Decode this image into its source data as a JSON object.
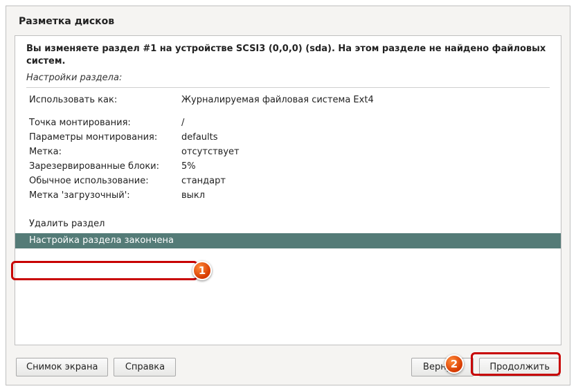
{
  "title": "Разметка дисков",
  "info": "Вы изменяете раздел #1 на устройстве SCSI3 (0,0,0) (sda). На этом разделе не найдено файловых систем.",
  "subtitle": "Настройки раздела:",
  "settings": [
    {
      "label": "Использовать как:",
      "value": "Журналируемая файловая система Ext4"
    },
    {
      "label": "",
      "value": ""
    },
    {
      "label": "Точка монтирования:",
      "value": "/"
    },
    {
      "label": "Параметры монтирования:",
      "value": "defaults"
    },
    {
      "label": "Метка:",
      "value": "отсутствует"
    },
    {
      "label": "Зарезервированные блоки:",
      "value": "5%"
    },
    {
      "label": "Обычное использование:",
      "value": "стандарт"
    },
    {
      "label": "Метка 'загрузочный':",
      "value": "выкл"
    }
  ],
  "actions": {
    "delete": "Удалить раздел",
    "done": "Настройка раздела закончена"
  },
  "buttons": {
    "screenshot": "Снимок экрана",
    "help": "Справка",
    "back": "Вернуть",
    "continue": "Продолжить"
  },
  "annotations": {
    "badge1": "1",
    "badge2": "2"
  }
}
